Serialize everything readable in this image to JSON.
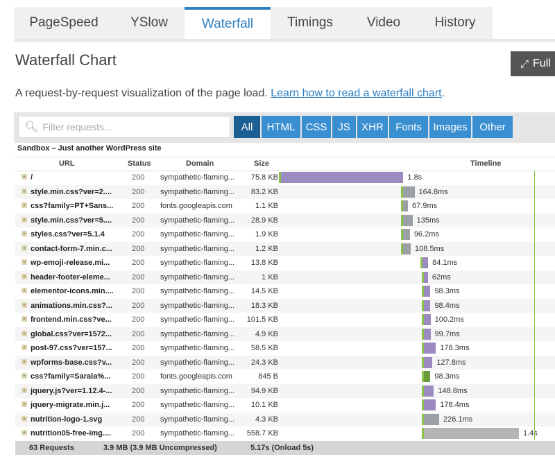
{
  "tabs": [
    {
      "label": "PageSpeed",
      "active": false
    },
    {
      "label": "YSlow",
      "active": false
    },
    {
      "label": "Waterfall",
      "active": true
    },
    {
      "label": "Timings",
      "active": false
    },
    {
      "label": "Video",
      "active": false
    },
    {
      "label": "History",
      "active": false
    }
  ],
  "page_title": "Waterfall Chart",
  "full_button": {
    "label": "Full",
    "icon": "expand-icon"
  },
  "description": {
    "text": "A request-by-request visualization of the page load. ",
    "link": "Learn how to read a waterfall chart",
    "tail": "."
  },
  "search": {
    "placeholder": "Filter requests...",
    "icon": "search-icon"
  },
  "filters": [
    {
      "label": "All",
      "active": true
    },
    {
      "label": "HTML"
    },
    {
      "label": "CSS"
    },
    {
      "label": "JS"
    },
    {
      "label": "XHR"
    },
    {
      "label": "Fonts"
    },
    {
      "label": "Images"
    },
    {
      "label": "Other"
    }
  ],
  "site_title": "Sandbox – Just another WordPress site",
  "columns": {
    "url": "URL",
    "status": "Status",
    "domain": "Domain",
    "size": "Size",
    "timeline": "Timeline"
  },
  "requests": [
    {
      "url": "/",
      "status": "200",
      "domain": "sympathetic-flaming...",
      "size": "75.8 KB",
      "time": "1.8s",
      "start": 0.0,
      "total": 1.8,
      "main": "#9b8bc0"
    },
    {
      "url": "style.min.css?ver=2....",
      "status": "200",
      "domain": "sympathetic-flaming...",
      "size": "83.2 KB",
      "time": "164.8ms",
      "start": 1.8,
      "total": 0.1648,
      "main": "#9aa0a6"
    },
    {
      "url": "css?family=PT+Sans...",
      "status": "200",
      "domain": "fonts.googleapis.com",
      "size": "1.1 KB",
      "time": "67.9ms",
      "start": 1.8,
      "total": 0.0679,
      "main": "#9aa0a6"
    },
    {
      "url": "style.min.css?ver=5....",
      "status": "200",
      "domain": "sympathetic-flaming...",
      "size": "28.9 KB",
      "time": "135ms",
      "start": 1.8,
      "total": 0.135,
      "main": "#9aa0a6"
    },
    {
      "url": "styles.css?ver=5.1.4",
      "status": "200",
      "domain": "sympathetic-flaming...",
      "size": "1.9 KB",
      "time": "96.2ms",
      "start": 1.8,
      "total": 0.0962,
      "main": "#9aa0a6"
    },
    {
      "url": "contact-form-7.min.c...",
      "status": "200",
      "domain": "sympathetic-flaming...",
      "size": "1.2 KB",
      "time": "108.5ms",
      "start": 1.8,
      "total": 0.1085,
      "main": "#9aa0a6"
    },
    {
      "url": "wp-emoji-release.mi...",
      "status": "200",
      "domain": "sympathetic-flaming...",
      "size": "13.8 KB",
      "time": "84.1ms",
      "start": 2.08,
      "total": 0.0841,
      "main": "#9b8bc0"
    },
    {
      "url": "header-footer-eleme...",
      "status": "200",
      "domain": "sympathetic-flaming...",
      "size": "1 KB",
      "time": "62ms",
      "start": 2.1,
      "total": 0.062,
      "main": "#9b8bc0"
    },
    {
      "url": "elementor-icons.min....",
      "status": "200",
      "domain": "sympathetic-flaming...",
      "size": "14.5 KB",
      "time": "98.3ms",
      "start": 2.1,
      "total": 0.0983,
      "main": "#9b8bc0"
    },
    {
      "url": "animations.min.css?...",
      "status": "200",
      "domain": "sympathetic-flaming...",
      "size": "18.3 KB",
      "time": "98.4ms",
      "start": 2.1,
      "total": 0.0984,
      "main": "#9b8bc0"
    },
    {
      "url": "frontend.min.css?ve...",
      "status": "200",
      "domain": "sympathetic-flaming...",
      "size": "101.5 KB",
      "time": "100.2ms",
      "start": 2.1,
      "total": 0.1002,
      "main": "#9b8bc0"
    },
    {
      "url": "global.css?ver=1572...",
      "status": "200",
      "domain": "sympathetic-flaming...",
      "size": "4.9 KB",
      "time": "99.7ms",
      "start": 2.1,
      "total": 0.0997,
      "main": "#9b8bc0"
    },
    {
      "url": "post-97.css?ver=157...",
      "status": "200",
      "domain": "sympathetic-flaming...",
      "size": "58.5 KB",
      "time": "178.3ms",
      "start": 2.1,
      "total": 0.1783,
      "main": "#9b8bc0"
    },
    {
      "url": "wpforms-base.css?v...",
      "status": "200",
      "domain": "sympathetic-flaming...",
      "size": "24.3 KB",
      "time": "127.8ms",
      "start": 2.1,
      "total": 0.1278,
      "main": "#9b8bc0"
    },
    {
      "url": "css?family=Sarala%...",
      "status": "200",
      "domain": "fonts.googleapis.com",
      "size": "845 B",
      "time": "98.3ms",
      "start": 2.1,
      "total": 0.0983,
      "main": "#6a9a3a"
    },
    {
      "url": "jquery.js?ver=1.12.4-...",
      "status": "200",
      "domain": "sympathetic-flaming...",
      "size": "94.9 KB",
      "time": "148.8ms",
      "start": 2.1,
      "total": 0.1488,
      "main": "#9b8bc0"
    },
    {
      "url": "jquery-migrate.min.j...",
      "status": "200",
      "domain": "sympathetic-flaming...",
      "size": "10.1 KB",
      "time": "178.4ms",
      "start": 2.1,
      "total": 0.1784,
      "main": "#9b8bc0"
    },
    {
      "url": "nutrition-logo-1.svg",
      "status": "200",
      "domain": "sympathetic-flaming...",
      "size": "4.3 KB",
      "time": "226.1ms",
      "start": 2.1,
      "total": 0.2261,
      "main": "#9aa0a6"
    },
    {
      "url": "nutrition05-free-img....",
      "status": "200",
      "domain": "sympathetic-flaming...",
      "size": "558.7 KB",
      "time": "1.4s",
      "start": 2.1,
      "total": 1.4,
      "main": "#b5b5b5"
    }
  ],
  "footer": {
    "requests": "63 Requests",
    "size": "3.9 MB (3.9 MB Uncompressed)",
    "time": "5.17s (Onload 5s)"
  },
  "colors": {
    "accent": "#2d7fc1",
    "filter_bg": "#3a8fd1",
    "filter_active": "#1b5f93",
    "dns_wait": "#e8dcc4",
    "connect": "#8bc34a",
    "ssl": "#b4a7d6",
    "onload_line": "#8bc34a"
  }
}
